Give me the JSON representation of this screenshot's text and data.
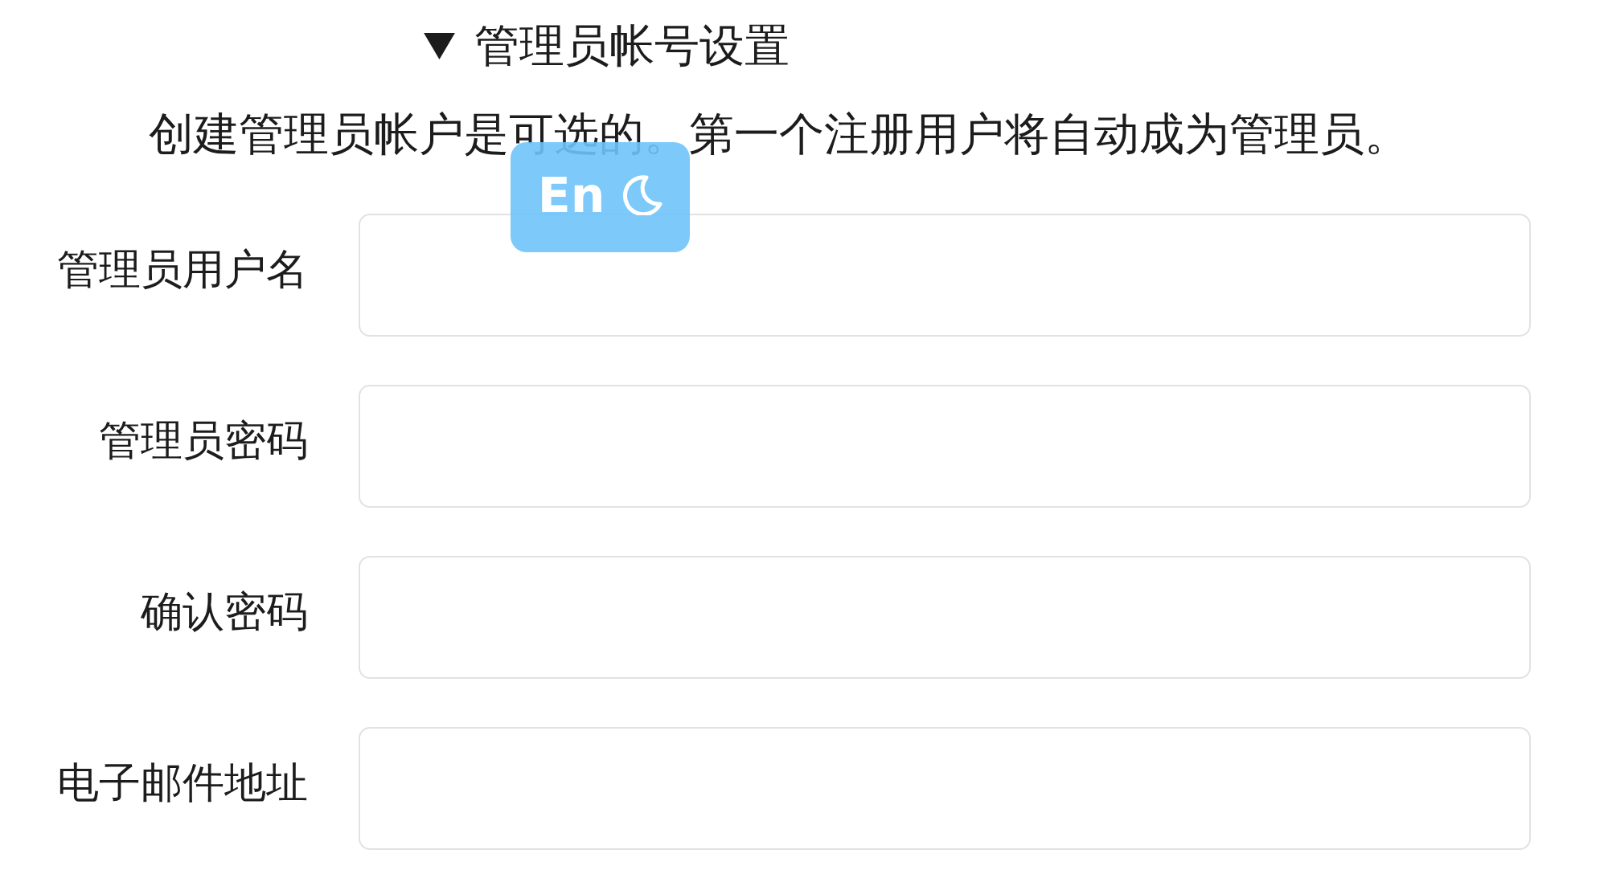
{
  "admin_section": {
    "title": "管理员帐号设置",
    "expanded": true,
    "description": "创建管理员帐户是可选的。第一个注册用户将自动成为管理员。",
    "fields": [
      {
        "label": "管理员用户名"
      },
      {
        "label": "管理员密码"
      },
      {
        "label": "确认密码"
      },
      {
        "label": "电子邮件地址"
      }
    ]
  },
  "ime_indicator": {
    "label": "En"
  }
}
